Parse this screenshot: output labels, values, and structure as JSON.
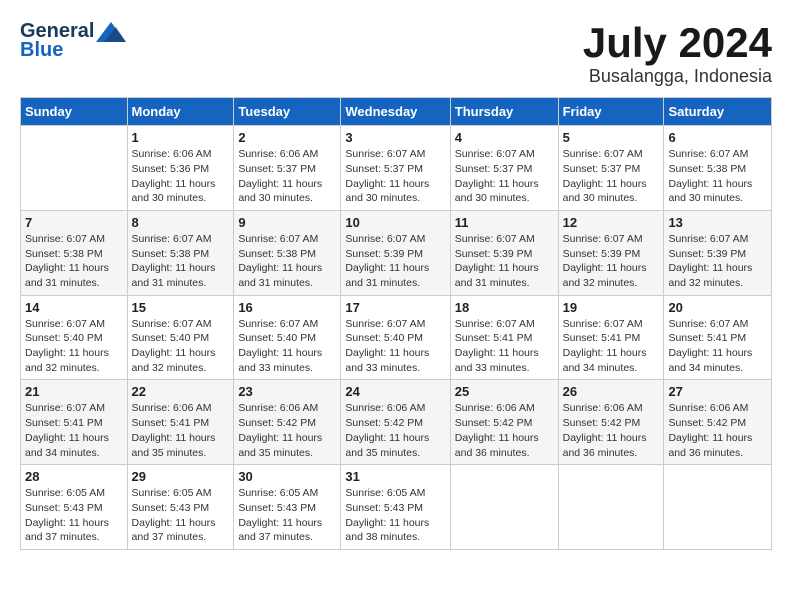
{
  "logo": {
    "general": "General",
    "blue": "Blue"
  },
  "title": "July 2024",
  "location": "Busalangga, Indonesia",
  "days_of_week": [
    "Sunday",
    "Monday",
    "Tuesday",
    "Wednesday",
    "Thursday",
    "Friday",
    "Saturday"
  ],
  "weeks": [
    [
      {
        "num": "",
        "info": ""
      },
      {
        "num": "1",
        "info": "Sunrise: 6:06 AM\nSunset: 5:36 PM\nDaylight: 11 hours\nand 30 minutes."
      },
      {
        "num": "2",
        "info": "Sunrise: 6:06 AM\nSunset: 5:37 PM\nDaylight: 11 hours\nand 30 minutes."
      },
      {
        "num": "3",
        "info": "Sunrise: 6:07 AM\nSunset: 5:37 PM\nDaylight: 11 hours\nand 30 minutes."
      },
      {
        "num": "4",
        "info": "Sunrise: 6:07 AM\nSunset: 5:37 PM\nDaylight: 11 hours\nand 30 minutes."
      },
      {
        "num": "5",
        "info": "Sunrise: 6:07 AM\nSunset: 5:37 PM\nDaylight: 11 hours\nand 30 minutes."
      },
      {
        "num": "6",
        "info": "Sunrise: 6:07 AM\nSunset: 5:38 PM\nDaylight: 11 hours\nand 30 minutes."
      }
    ],
    [
      {
        "num": "7",
        "info": "Sunrise: 6:07 AM\nSunset: 5:38 PM\nDaylight: 11 hours\nand 31 minutes."
      },
      {
        "num": "8",
        "info": "Sunrise: 6:07 AM\nSunset: 5:38 PM\nDaylight: 11 hours\nand 31 minutes."
      },
      {
        "num": "9",
        "info": "Sunrise: 6:07 AM\nSunset: 5:38 PM\nDaylight: 11 hours\nand 31 minutes."
      },
      {
        "num": "10",
        "info": "Sunrise: 6:07 AM\nSunset: 5:39 PM\nDaylight: 11 hours\nand 31 minutes."
      },
      {
        "num": "11",
        "info": "Sunrise: 6:07 AM\nSunset: 5:39 PM\nDaylight: 11 hours\nand 31 minutes."
      },
      {
        "num": "12",
        "info": "Sunrise: 6:07 AM\nSunset: 5:39 PM\nDaylight: 11 hours\nand 32 minutes."
      },
      {
        "num": "13",
        "info": "Sunrise: 6:07 AM\nSunset: 5:39 PM\nDaylight: 11 hours\nand 32 minutes."
      }
    ],
    [
      {
        "num": "14",
        "info": "Sunrise: 6:07 AM\nSunset: 5:40 PM\nDaylight: 11 hours\nand 32 minutes."
      },
      {
        "num": "15",
        "info": "Sunrise: 6:07 AM\nSunset: 5:40 PM\nDaylight: 11 hours\nand 32 minutes."
      },
      {
        "num": "16",
        "info": "Sunrise: 6:07 AM\nSunset: 5:40 PM\nDaylight: 11 hours\nand 33 minutes."
      },
      {
        "num": "17",
        "info": "Sunrise: 6:07 AM\nSunset: 5:40 PM\nDaylight: 11 hours\nand 33 minutes."
      },
      {
        "num": "18",
        "info": "Sunrise: 6:07 AM\nSunset: 5:41 PM\nDaylight: 11 hours\nand 33 minutes."
      },
      {
        "num": "19",
        "info": "Sunrise: 6:07 AM\nSunset: 5:41 PM\nDaylight: 11 hours\nand 34 minutes."
      },
      {
        "num": "20",
        "info": "Sunrise: 6:07 AM\nSunset: 5:41 PM\nDaylight: 11 hours\nand 34 minutes."
      }
    ],
    [
      {
        "num": "21",
        "info": "Sunrise: 6:07 AM\nSunset: 5:41 PM\nDaylight: 11 hours\nand 34 minutes."
      },
      {
        "num": "22",
        "info": "Sunrise: 6:06 AM\nSunset: 5:41 PM\nDaylight: 11 hours\nand 35 minutes."
      },
      {
        "num": "23",
        "info": "Sunrise: 6:06 AM\nSunset: 5:42 PM\nDaylight: 11 hours\nand 35 minutes."
      },
      {
        "num": "24",
        "info": "Sunrise: 6:06 AM\nSunset: 5:42 PM\nDaylight: 11 hours\nand 35 minutes."
      },
      {
        "num": "25",
        "info": "Sunrise: 6:06 AM\nSunset: 5:42 PM\nDaylight: 11 hours\nand 36 minutes."
      },
      {
        "num": "26",
        "info": "Sunrise: 6:06 AM\nSunset: 5:42 PM\nDaylight: 11 hours\nand 36 minutes."
      },
      {
        "num": "27",
        "info": "Sunrise: 6:06 AM\nSunset: 5:42 PM\nDaylight: 11 hours\nand 36 minutes."
      }
    ],
    [
      {
        "num": "28",
        "info": "Sunrise: 6:05 AM\nSunset: 5:43 PM\nDaylight: 11 hours\nand 37 minutes."
      },
      {
        "num": "29",
        "info": "Sunrise: 6:05 AM\nSunset: 5:43 PM\nDaylight: 11 hours\nand 37 minutes."
      },
      {
        "num": "30",
        "info": "Sunrise: 6:05 AM\nSunset: 5:43 PM\nDaylight: 11 hours\nand 37 minutes."
      },
      {
        "num": "31",
        "info": "Sunrise: 6:05 AM\nSunset: 5:43 PM\nDaylight: 11 hours\nand 38 minutes."
      },
      {
        "num": "",
        "info": ""
      },
      {
        "num": "",
        "info": ""
      },
      {
        "num": "",
        "info": ""
      }
    ]
  ]
}
